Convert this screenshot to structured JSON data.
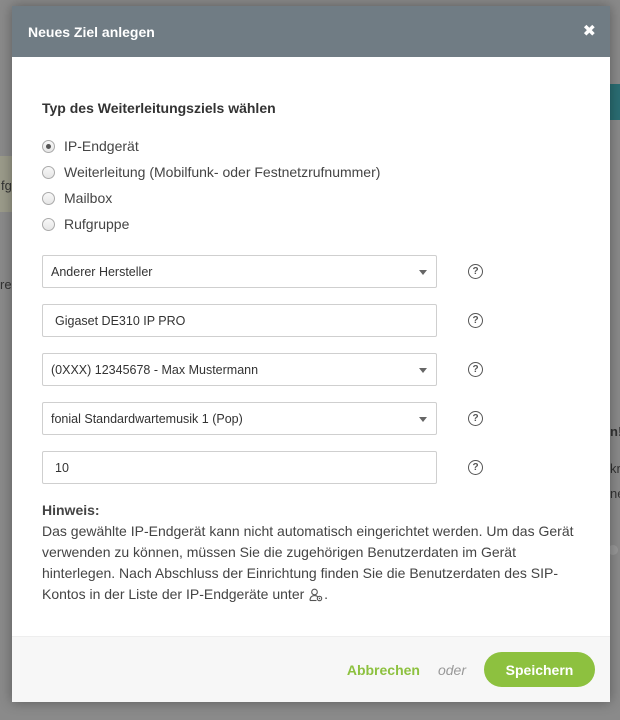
{
  "modal": {
    "title": "Neues Ziel anlegen",
    "close_glyph": "✖"
  },
  "section": {
    "heading": "Typ des Weiterleitungsziels wählen"
  },
  "radio_options": [
    {
      "label": "IP-Endgerät",
      "checked": true
    },
    {
      "label": "Weiterleitung (Mobilfunk- oder Festnetzrufnummer)",
      "checked": false
    },
    {
      "label": "Mailbox",
      "checked": false
    },
    {
      "label": "Rufgruppe",
      "checked": false
    }
  ],
  "fields": {
    "manufacturer_value": "Anderer Hersteller",
    "device_name_value": "Gigaset DE310 IP PRO",
    "number_value": "(0XXX) 12345678 - Max Mustermann",
    "music_value": "fonial Standardwartemusik 1 (Pop)",
    "count_value": "10",
    "help_glyph": "?"
  },
  "hint": {
    "heading": "Hinweis:",
    "text_before_icon": "Das gewählte IP-Endgerät kann nicht automatisch eingerichtet werden. Um das Gerät verwenden zu können, müssen Sie die zugehörigen Benutzerdaten im Gerät hinterlegen. Nach Abschluss der Einrichtung finden Sie die Benutzerdaten des SIP-Kontos in der Liste der IP-Endgeräte unter",
    "text_after_icon": "."
  },
  "footer": {
    "cancel_label": "Abbrechen",
    "or_label": "oder",
    "save_label": "Speichern"
  },
  "background": {
    "fragment_1": "fg",
    "fragment_2": "res",
    "fragment_3": "n!",
    "fragment_4": "kr",
    "fragment_5": "ne"
  },
  "colors": {
    "header": "#707c84",
    "accent_green": "#8dc13f"
  }
}
